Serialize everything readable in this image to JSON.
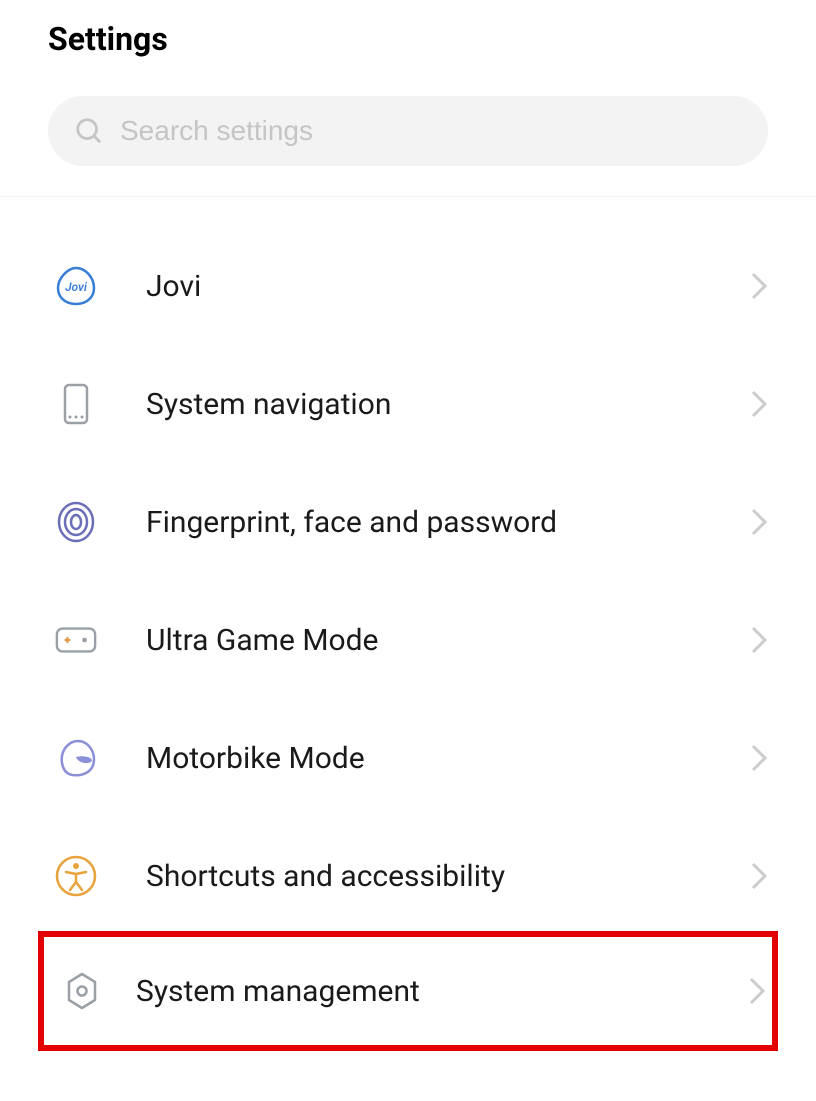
{
  "header": {
    "title": "Settings"
  },
  "search": {
    "placeholder": "Search settings",
    "value": ""
  },
  "items": [
    {
      "id": "jovi",
      "icon": "jovi-icon",
      "label": "Jovi",
      "highlighted": false
    },
    {
      "id": "system-navigation",
      "icon": "phone-icon",
      "label": "System navigation",
      "highlighted": false
    },
    {
      "id": "fingerprint-face-password",
      "icon": "fingerprint-icon",
      "label": "Fingerprint, face and password",
      "highlighted": false
    },
    {
      "id": "ultra-game-mode",
      "icon": "gamepad-icon",
      "label": "Ultra Game Mode",
      "highlighted": false
    },
    {
      "id": "motorbike-mode",
      "icon": "helmet-icon",
      "label": "Motorbike Mode",
      "highlighted": false
    },
    {
      "id": "shortcuts-accessibility",
      "icon": "accessibility-icon",
      "label": "Shortcuts and accessibility",
      "highlighted": false
    },
    {
      "id": "system-management",
      "icon": "gear-hex-icon",
      "label": "System management",
      "highlighted": true
    }
  ],
  "colors": {
    "jovi_blue": "#3a7fd5",
    "nav_gray": "#9aa0a6",
    "fingerprint_purple": "#6b6fb8",
    "game_orange": "#e0a050",
    "game_gray": "#9aa0a6",
    "helmet_purple": "#8a8fd6",
    "accessibility_orange": "#e9a33c",
    "system_gray": "#9aa0a6",
    "highlight_red": "#e30000",
    "chevron_gray": "#cccccc"
  }
}
